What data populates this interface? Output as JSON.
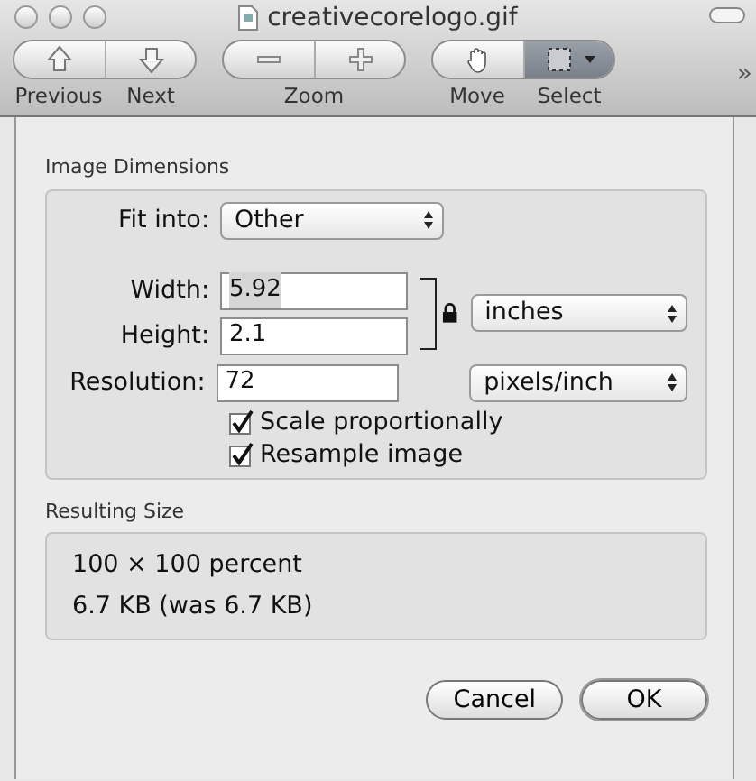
{
  "window": {
    "title": "creativecorelogo.gif"
  },
  "toolbar": [
    {
      "kind": "split",
      "segments": [
        {
          "kind": "up",
          "label": "Previous",
          "selected": false
        },
        {
          "kind": "down",
          "label": "Next",
          "selected": false
        }
      ]
    },
    {
      "kind": "joined",
      "label": "Zoom",
      "segments": [
        {
          "kind": "minus",
          "selected": false
        },
        {
          "kind": "plus",
          "selected": false
        }
      ]
    },
    {
      "kind": "split",
      "segments": [
        {
          "kind": "hand",
          "label": "Move",
          "selected": false
        },
        {
          "kind": "marquee",
          "label": "Select",
          "selected": true,
          "menu": true
        }
      ]
    }
  ],
  "overflow": "»",
  "image_dimensions": {
    "title": "Image Dimensions",
    "fit_into": {
      "label": "Fit into:",
      "value": "Other"
    },
    "width": {
      "label": "Width:",
      "value": "5.92",
      "text_selected": true
    },
    "height": {
      "label": "Height:",
      "value": "2.1",
      "text_selected": false
    },
    "size_units": "inches",
    "resolution": {
      "label": "Resolution:",
      "value": "72",
      "units": "pixels/inch"
    },
    "options": [
      {
        "label": "Scale proportionally",
        "checked": true
      },
      {
        "label": "Resample image",
        "checked": true
      }
    ]
  },
  "resulting_size": {
    "title": "Resulting Size",
    "lines": [
      "100 × 100 percent",
      "6.7 KB (was 6.7 KB)"
    ]
  },
  "buttons": [
    {
      "label": "Cancel",
      "default": false
    },
    {
      "label": "OK",
      "default": true
    }
  ]
}
